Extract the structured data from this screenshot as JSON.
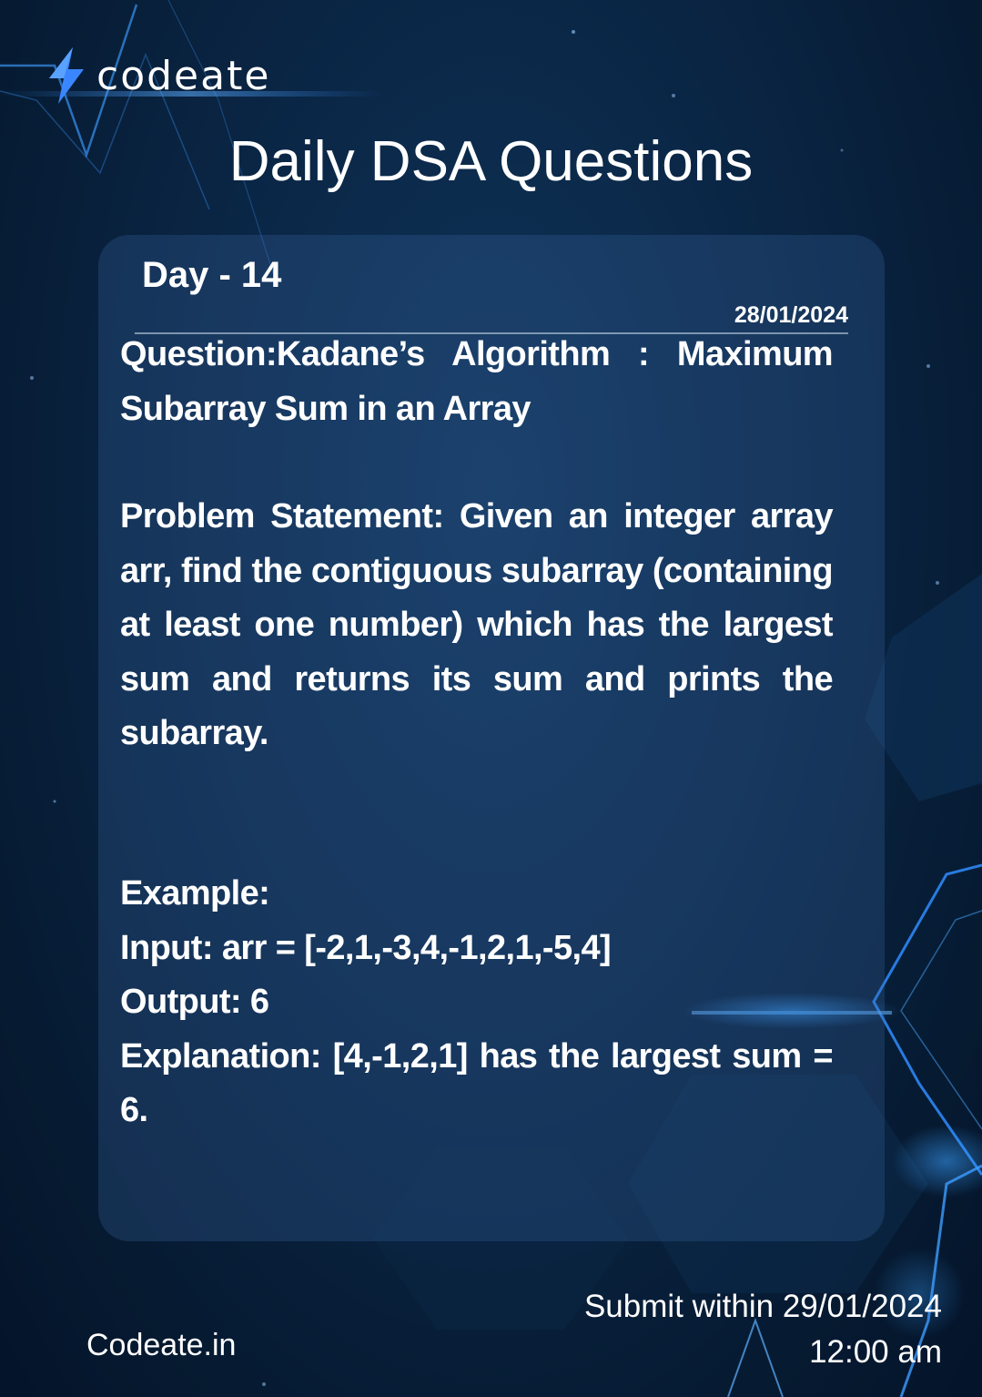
{
  "brand": {
    "logo_text": "codeate",
    "accent_color": "#3a86ff",
    "logo_icon": "lightning-bolt-icon"
  },
  "header": {
    "title": "Daily DSA Questions"
  },
  "card": {
    "day": "Day - 14",
    "date": "28/01/2024",
    "question": "Question:Kadane’s Algorithm : Maximum Subarray Sum in an Array",
    "problem_statement": "Problem Statement: Given an integer array arr, find the contiguous subarray (containing at least one number) which has the largest sum and returns its sum and prints the subarray.",
    "example": {
      "heading": "Example:",
      "input": "Input: arr = [-2,1,-3,4,-1,2,1,-5,4]",
      "output": "Output: 6",
      "explanation": "Explanation: [4,-1,2,1] has the largest sum = 6."
    }
  },
  "footer": {
    "website": "Codeate.in",
    "submit_line": "Submit within 29/01/2024",
    "submit_time": "12:00 am"
  }
}
